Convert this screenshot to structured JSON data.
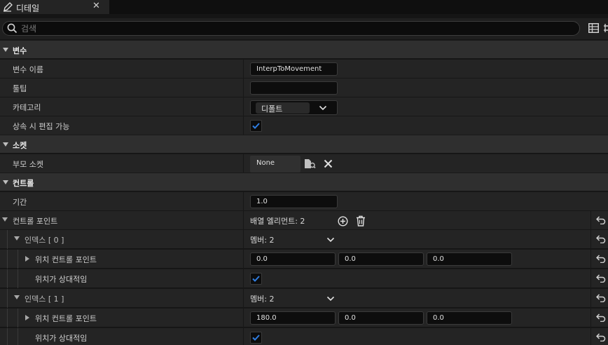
{
  "tab": {
    "title": "디테일",
    "close": "✕"
  },
  "search": {
    "placeholder": "검색",
    "value": ""
  },
  "sections": {
    "variables": "변수",
    "sockets": "소켓",
    "control": "컨트롤"
  },
  "variables": {
    "name_label": "변수 이름",
    "name_value": "InterpToMovement",
    "tooltip_label": "툴팁",
    "tooltip_value": "",
    "category_label": "카테고리",
    "category_value": "디폴트",
    "instance_editable_label": "상속 시 편집 가능",
    "instance_editable_checked": true
  },
  "sockets": {
    "parent_socket_label": "부모 소켓",
    "parent_socket_value": "None"
  },
  "control": {
    "duration_label": "기간",
    "duration_value": "1.0",
    "control_points_label": "컨트롤 포인트",
    "array_elements": "배열 엘리먼트: 2",
    "items": [
      {
        "index_label": "인덱스 [ 0 ]",
        "members": "멤버: 2",
        "position_label": "위치 컨트롤 포인트",
        "x": "0.0",
        "y": "0.0",
        "z": "0.0",
        "relative_label": "위치가 상대적임",
        "relative_checked": true
      },
      {
        "index_label": "인덱스 [ 1 ]",
        "members": "멤버: 2",
        "position_label": "위치 컨트롤 포인트",
        "x": "180.0",
        "y": "0.0",
        "z": "0.0",
        "relative_label": "위치가 상대적임",
        "relative_checked": true
      }
    ]
  },
  "colors": {
    "accent": "#2f7de1",
    "panel": "#242424",
    "section": "#2f2f2f"
  }
}
